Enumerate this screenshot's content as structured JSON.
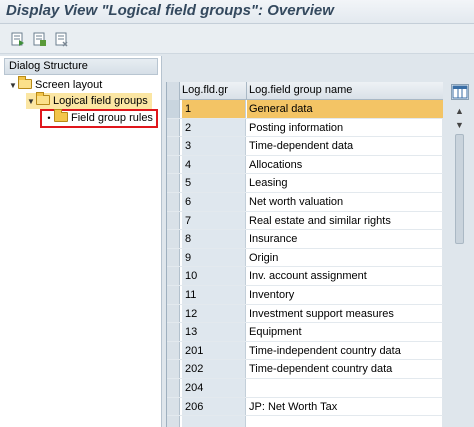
{
  "title": "Display View \"Logical field groups\": Overview",
  "toolbar": {
    "buttons": [
      {
        "icon": "display-detail-icon"
      },
      {
        "icon": "previous-entry-icon"
      },
      {
        "icon": "next-entry-icon"
      }
    ]
  },
  "dialog_structure": {
    "header": "Dialog Structure",
    "items": [
      {
        "label": "Screen layout",
        "level": 0,
        "expanded": true
      },
      {
        "label": "Logical field groups",
        "level": 1,
        "expanded": true,
        "selected": true
      },
      {
        "label": "Field group rules",
        "level": 2,
        "highlighted": true
      }
    ]
  },
  "table": {
    "columns": [
      "Log.fld.gr",
      "Log.field group name"
    ],
    "rows": [
      {
        "key": "1",
        "name": "General data"
      },
      {
        "key": "2",
        "name": "Posting information"
      },
      {
        "key": "3",
        "name": "Time-dependent data"
      },
      {
        "key": "4",
        "name": "Allocations"
      },
      {
        "key": "5",
        "name": "Leasing"
      },
      {
        "key": "6",
        "name": "Net worth valuation"
      },
      {
        "key": "7",
        "name": "Real estate and similar rights"
      },
      {
        "key": "8",
        "name": "Insurance"
      },
      {
        "key": "9",
        "name": "Origin"
      },
      {
        "key": "10",
        "name": "Inv. account assignment"
      },
      {
        "key": "11",
        "name": "Inventory"
      },
      {
        "key": "12",
        "name": "Investment support measures"
      },
      {
        "key": "13",
        "name": "Equipment"
      },
      {
        "key": "201",
        "name": "Time-independent country data"
      },
      {
        "key": "202",
        "name": "Time-dependent country data"
      },
      {
        "key": "204",
        "name": ""
      },
      {
        "key": "206",
        "name": "JP: Net Worth Tax"
      },
      {
        "key": "",
        "name": ""
      }
    ]
  },
  "colors": {
    "selected_row": "#f3c465",
    "highlight_border": "#e0161c",
    "title_text": "#34495e"
  }
}
